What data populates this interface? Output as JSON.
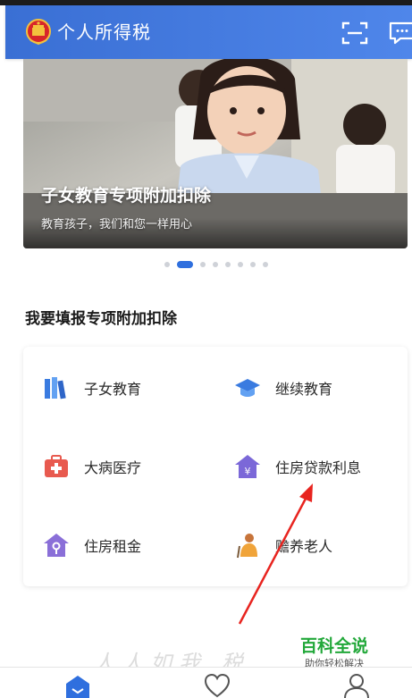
{
  "header": {
    "title": "个人所得税",
    "emblem_icon": "national-emblem-icon",
    "scan_icon": "scan-icon",
    "message_icon": "message-icon",
    "color": "#3f79e0"
  },
  "banner": {
    "title": "子女教育专项附加扣除",
    "subtitle": "教育孩子，我们和您一样用心",
    "total_slides": 8,
    "active_slide": 2
  },
  "section": {
    "title": "我要填报专项附加扣除"
  },
  "items": [
    {
      "label": "子女教育",
      "icon": "books-icon",
      "color": "#3a7be0"
    },
    {
      "label": "继续教育",
      "icon": "graduation-cap-icon",
      "color": "#3a7be0"
    },
    {
      "label": "大病医疗",
      "icon": "medical-kit-icon",
      "color": "#e85a4f"
    },
    {
      "label": "住房贷款利息",
      "icon": "house-yen-icon",
      "color": "#7b68d8"
    },
    {
      "label": "住房租金",
      "icon": "house-key-icon",
      "color": "#8a6fd8"
    },
    {
      "label": "赡养老人",
      "icon": "elderly-person-icon",
      "color": "#f0a43a"
    }
  ],
  "watermark": {
    "title": "百科全说",
    "subtitle": "助你轻松解决"
  },
  "tabbar": {
    "tabs": [
      {
        "icon": "home-icon"
      },
      {
        "icon": "favorites-icon"
      },
      {
        "icon": "profile-icon"
      }
    ]
  }
}
